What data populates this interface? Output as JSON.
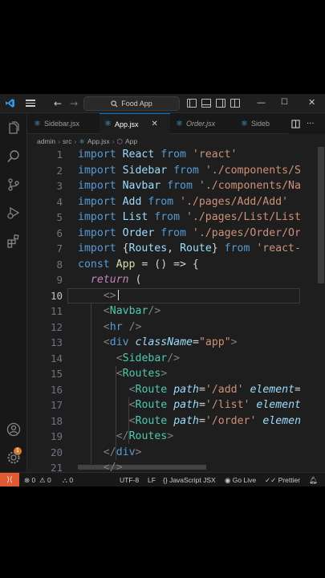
{
  "titlebar": {
    "search_text": "Food App",
    "nav_back": "←",
    "nav_forward": "→",
    "minimize": "—",
    "maximize": "☐",
    "close": "✕"
  },
  "tabs": [
    {
      "label": "Sidebar.jsx",
      "active": false
    },
    {
      "label": "App.jsx",
      "active": true,
      "close": "✕"
    },
    {
      "label": "Order.jsx",
      "active": false
    },
    {
      "label": "Sideb",
      "active": false
    }
  ],
  "breadcrumb": {
    "parts": [
      "admin",
      "src",
      "App.jsx",
      "App"
    ]
  },
  "editor": {
    "current_line": "10",
    "line_numbers": [
      "1",
      "2",
      "3",
      "4",
      "5",
      "6",
      "7",
      "8",
      "9",
      "10",
      "11",
      "12",
      "13",
      "14",
      "15",
      "16",
      "17",
      "18",
      "19",
      "20",
      "21"
    ]
  },
  "code": {
    "l1": [
      "import",
      " React ",
      "from",
      " 'react'"
    ],
    "l2": [
      "import",
      " Sidebar ",
      "from",
      " './components/S"
    ],
    "l3": [
      "import",
      " Navbar ",
      "from",
      " './components/Na"
    ],
    "l4": [
      "import",
      " Add ",
      "from",
      " './pages/Add/Add'"
    ],
    "l5": [
      "import",
      " List ",
      "from",
      " './pages/List/List"
    ],
    "l6": [
      "import",
      " Order ",
      "from",
      " './pages/Order/Or"
    ],
    "l7": [
      "import",
      " {",
      "Routes",
      ", ",
      "Route",
      "} ",
      "from",
      " 'react-"
    ],
    "l8": [
      "const",
      " App",
      " = () => {"
    ],
    "l9": [
      "return",
      " ("
    ],
    "l10": [
      "<>"
    ],
    "l11": [
      "<",
      "Navbar",
      "/>"
    ],
    "l12": [
      "<",
      "hr",
      " />"
    ],
    "l13": [
      "<",
      "div",
      " className",
      "=",
      "\"app\"",
      ">"
    ],
    "l14": [
      "<",
      "Sidebar",
      "/>"
    ],
    "l15": [
      "<",
      "Routes",
      ">"
    ],
    "l16": [
      "<",
      "Route",
      " path",
      "=",
      "'/add'",
      " element",
      "="
    ],
    "l17": [
      "<",
      "Route",
      " path",
      "=",
      "'/list'",
      " element"
    ],
    "l18": [
      "<",
      "Route",
      " path",
      "=",
      "'/order'",
      " elemen"
    ],
    "l19": [
      "</",
      "Routes",
      ">"
    ],
    "l20": [
      "</",
      "div",
      ">"
    ],
    "l21": [
      "</>"
    ]
  },
  "statusbar": {
    "errors": "0",
    "warnings": "0",
    "ports": "0",
    "encoding": "UTF-8",
    "eol": "LF",
    "language": "JavaScript JSX",
    "golive": "Go Live",
    "prettier": "Prettier",
    "badge_count": "1"
  },
  "colors": {
    "accent": "#0078d4",
    "remote": "#e05a32",
    "keyword": "#569cd6",
    "control": "#c586c0",
    "variable": "#9cdcfe",
    "string": "#ce9178",
    "component": "#4ec9b0"
  }
}
